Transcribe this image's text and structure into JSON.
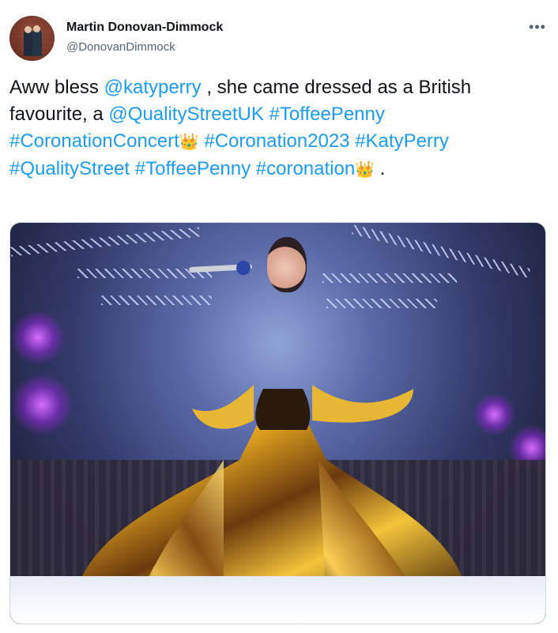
{
  "tweet": {
    "author_name": "Martin Donovan-Dimmock",
    "author_handle": "@DonovanDimmock",
    "more_icon": "more-horizontal-icon",
    "text_segments": [
      {
        "t": "Aww bless ",
        "link": false
      },
      {
        "t": "@katyperry",
        "link": true
      },
      {
        "t": " , she came dressed as a British favourite, a ",
        "link": false
      },
      {
        "t": "@QualityStreetUK",
        "link": true
      },
      {
        "t": " ",
        "link": false
      },
      {
        "t": "#ToffeePenny",
        "link": true
      },
      {
        "t": " ",
        "link": false
      },
      {
        "t": "#CoronationConcert",
        "link": true
      },
      {
        "t": "👑",
        "link": false,
        "emoji": true
      },
      {
        "t": "  ",
        "link": false
      },
      {
        "t": "#Coronation2023",
        "link": true
      },
      {
        "t": " ",
        "link": false
      },
      {
        "t": "#KatyPerry",
        "link": true
      },
      {
        "t": " ",
        "link": false
      },
      {
        "t": "#QualityStreet",
        "link": true
      },
      {
        "t": " ",
        "link": false
      },
      {
        "t": "#ToffeePenny",
        "link": true
      },
      {
        "t": " ",
        "link": false
      },
      {
        "t": "#coronation",
        "link": true
      },
      {
        "t": "👑",
        "link": false,
        "emoji": true
      },
      {
        "t": " .",
        "link": false
      }
    ]
  },
  "colors": {
    "link": "#1d9bf0",
    "text": "#0f1419",
    "secondary": "#536471",
    "border": "#cfd9de"
  }
}
